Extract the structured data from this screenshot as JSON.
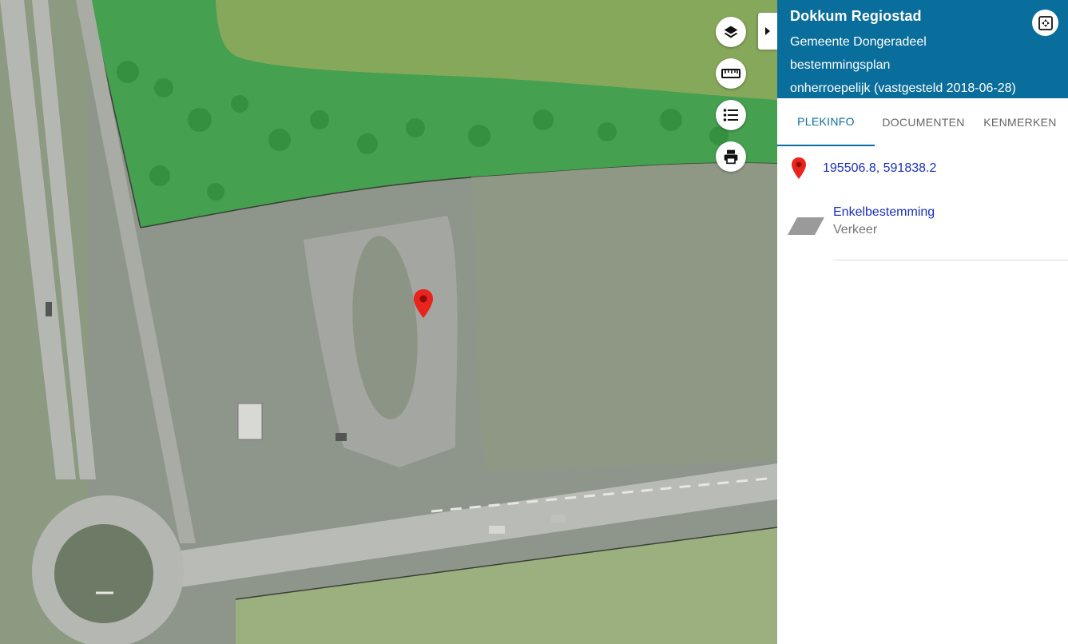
{
  "map": {
    "controls": [
      {
        "name": "layers-button",
        "icon": "layers-icon"
      },
      {
        "name": "measure-button",
        "icon": "ruler-icon"
      },
      {
        "name": "legend-button",
        "icon": "list-icon"
      },
      {
        "name": "print-button",
        "icon": "printer-icon"
      }
    ],
    "marker_icon": "map-pin-icon",
    "colors": {
      "green_zone": "#3fa14a",
      "road": "#b9bbb5",
      "field": "#7da65a"
    }
  },
  "panel": {
    "title": "Dokkum Regiostad",
    "municipality": "Gemeente Dongeradeel",
    "plan_type": "bestemmingsplan",
    "status": "onherroepelijk (vastgesteld 2018-06-28)",
    "header_color": "#0a6e9c",
    "tabs": {
      "plekinfo": "PLEKINFO",
      "documenten": "DOCUMENTEN",
      "kenmerken": "KENMERKEN"
    },
    "active_tab": "PLEKINFO",
    "coordinates": "195506.8, 591838.2",
    "bestemming": {
      "label": "Enkelbestemming",
      "value": "Verkeer"
    }
  }
}
